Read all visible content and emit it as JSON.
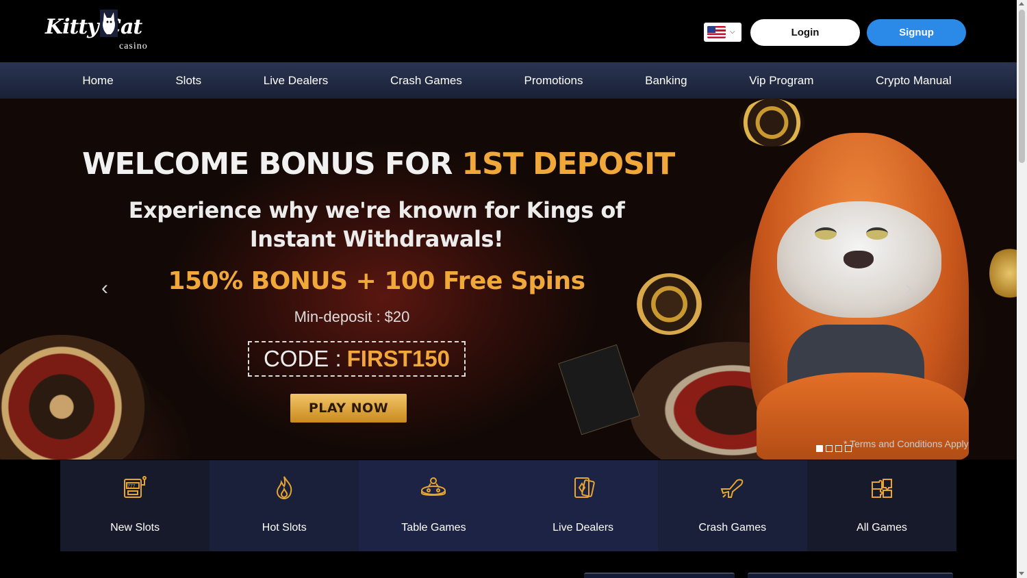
{
  "header": {
    "logo_text": "Kitty Cat",
    "logo_sub": "casino",
    "language_flag": "us-flag-icon",
    "login_label": "Login",
    "signup_label": "Signup"
  },
  "nav": {
    "items": [
      "Home",
      "Slots",
      "Live Dealers",
      "Crash Games",
      "Promotions",
      "Banking",
      "Vip Program",
      "Crypto Manual"
    ]
  },
  "hero": {
    "title_white": "WELCOME BONUS FOR",
    "title_orange": "1ST DEPOSIT",
    "subtitle": "Experience why we're known for Kings of Instant Withdrawals!",
    "bonus": "150% BONUS + 100 Free Spins",
    "min_deposit": "Min-deposit : $20",
    "code_label": "CODE :",
    "code_value": "FIRST150",
    "play_label": "PLAY NOW",
    "terms": "* Terms and Conditions Apply",
    "prev_arrow": "‹",
    "next_arrow": "›",
    "slides": 4,
    "active_slide": 1
  },
  "categories": [
    {
      "label": "New Slots",
      "icon": "slot-machine-icon"
    },
    {
      "label": "Hot Slots",
      "icon": "flame-icon"
    },
    {
      "label": "Table Games",
      "icon": "table-games-icon"
    },
    {
      "label": "Live Dealers",
      "icon": "live-dealer-icon"
    },
    {
      "label": "Crash Games",
      "icon": "airplane-icon"
    },
    {
      "label": "All Games",
      "icon": "puzzle-icon"
    }
  ],
  "colors": {
    "accent_orange": "#f0a83a",
    "signup_blue": "#2b8ae8",
    "nav_bg": "#2a3552",
    "icon_gold": "#e8a630"
  }
}
